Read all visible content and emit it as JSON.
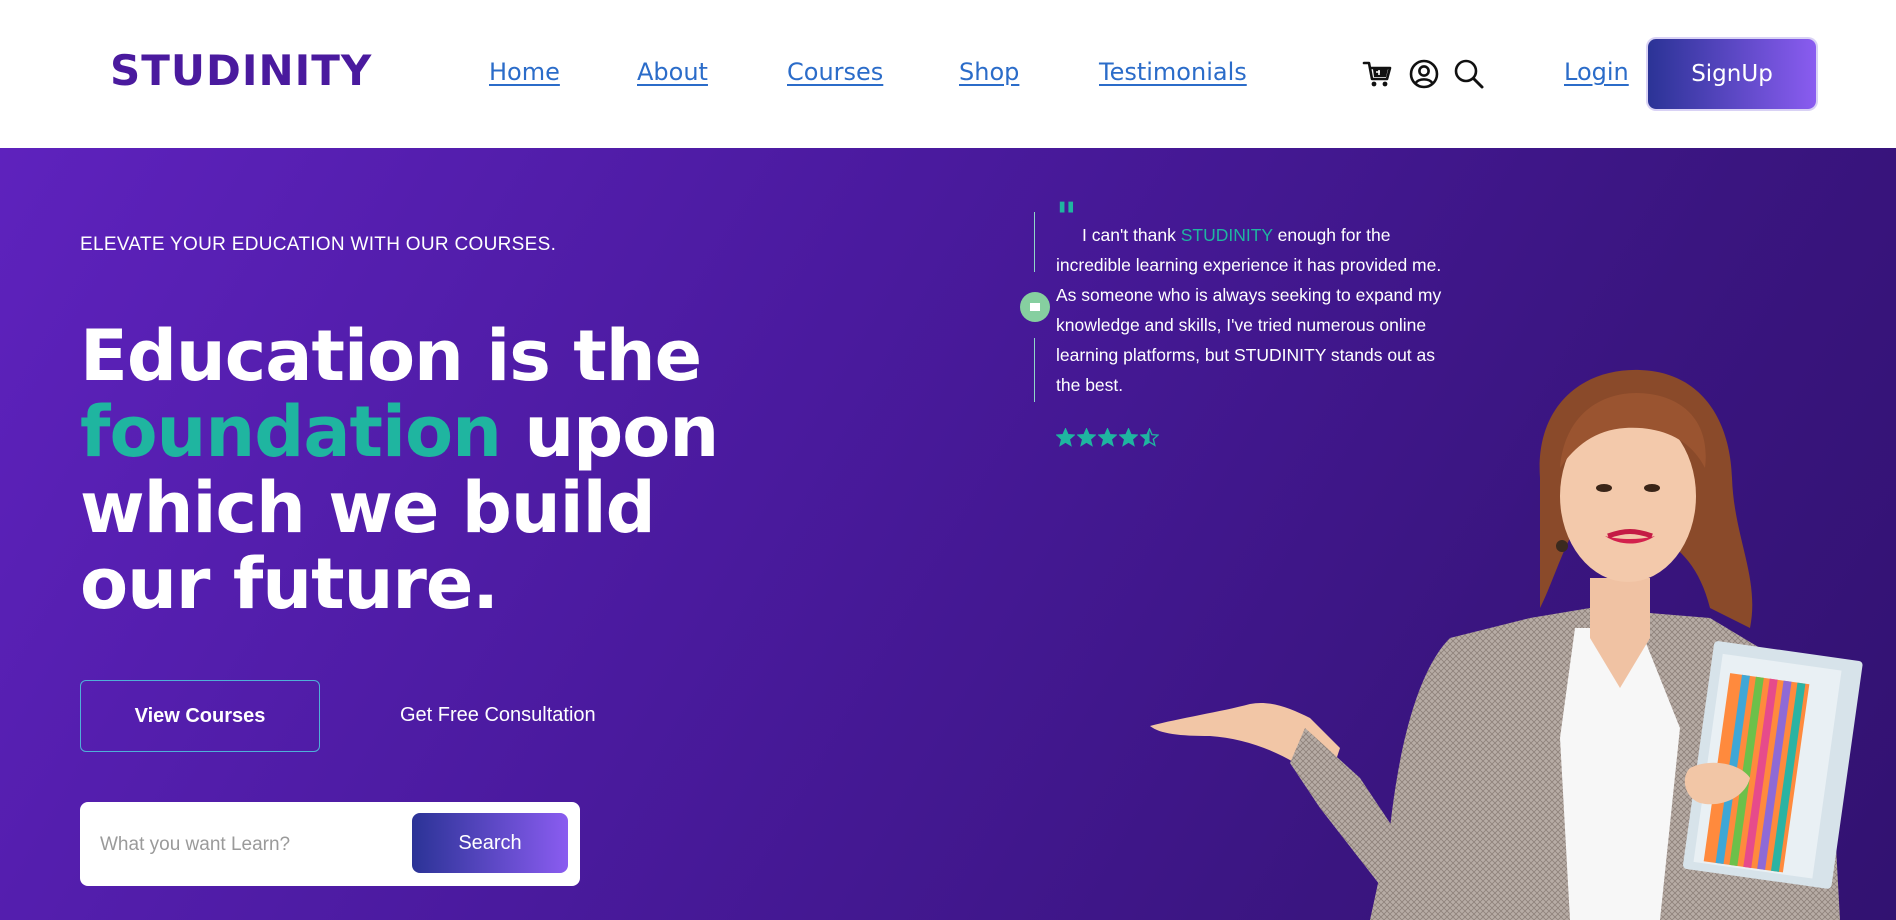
{
  "brand": {
    "logo": "STUDINITY"
  },
  "nav": {
    "links": [
      "Home",
      "About",
      "Courses",
      "Shop",
      "Testimonials"
    ],
    "icons": [
      "cart-icon",
      "user-circle-icon",
      "search-icon"
    ],
    "login": "Login",
    "signup": "SignUp"
  },
  "hero": {
    "tagline": "ELEVATE YOUR EDUCATION WITH OUR COURSES.",
    "headline": {
      "part1": "Education is the",
      "accent": "foundation",
      "part2": "upon which we build our future."
    },
    "view_courses": "View Courses",
    "consultation": "Get Free Consultation",
    "search": {
      "placeholder": "What you want Learn?",
      "value": "",
      "button": "Search"
    }
  },
  "testimonial": {
    "quote_mark": "\"",
    "text_before": "I can't thank",
    "brand": "STUDINITY",
    "text_after": "enough for the incredible learning experience it has provided me. As someone who is always seeking to expand my knowledge and skills, I've tried numerous online learning platforms, but STUDINITY stands out as the best.",
    "rating": 4.5,
    "rating_max": 5
  },
  "colors": {
    "brand_purple": "#4a1a9e",
    "accent_teal": "#1fb5a0",
    "link_blue": "#2b6cc9",
    "button_gradient_start": "#2b3396",
    "button_gradient_end": "#8a5cf0"
  }
}
